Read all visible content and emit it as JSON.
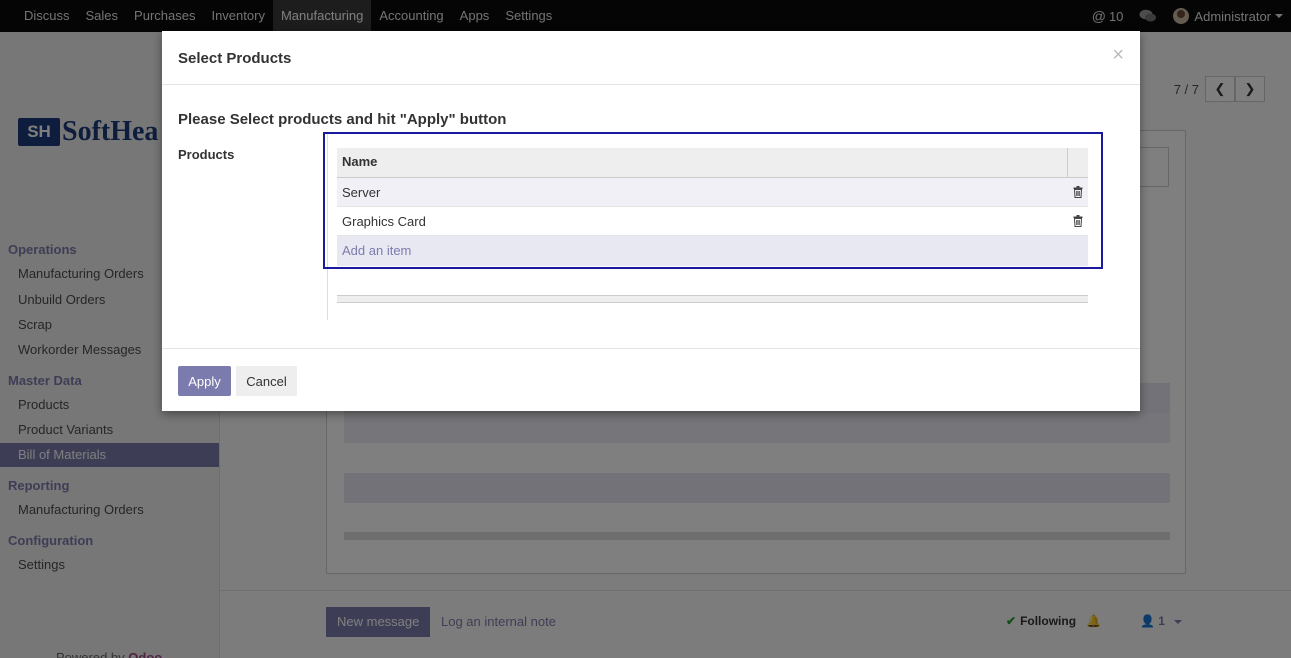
{
  "navbar": {
    "menu": [
      "Discuss",
      "Sales",
      "Purchases",
      "Inventory",
      "Manufacturing",
      "Accounting",
      "Apps",
      "Settings"
    ],
    "active": "Manufacturing",
    "mentions_count": "10",
    "user_name": "Administrator"
  },
  "sidebar": {
    "logo_mark": "SH",
    "logo_text": "SoftHea",
    "sections": [
      {
        "title": "Operations",
        "items": [
          "Manufacturing Orders",
          "Unbuild Orders",
          "Scrap",
          "Workorder Messages"
        ]
      },
      {
        "title": "Master Data",
        "items": [
          "Products",
          "Product Variants",
          "Bill of Materials"
        ]
      },
      {
        "title": "Reporting",
        "items": [
          "Manufacturing Orders"
        ]
      },
      {
        "title": "Configuration",
        "items": [
          "Settings"
        ]
      }
    ],
    "active_item": "Bill of Materials",
    "powered_by": "Powered by",
    "powered_brand": "Odoo"
  },
  "main": {
    "pager_value": "7 / 7"
  },
  "chatter": {
    "new_message": "New message",
    "log_note": "Log an internal note",
    "following": "Following",
    "followers_count": "1"
  },
  "modal": {
    "title": "Select Products",
    "close_symbol": "×",
    "instruction": "Please Select products and hit \"Apply\" button",
    "field_label": "Products",
    "table": {
      "column_name": "Name",
      "rows": [
        "Server",
        "Graphics Card"
      ],
      "add_item": "Add an item"
    },
    "apply_label": "Apply",
    "cancel_label": "Cancel"
  },
  "colors": {
    "accent": "#7c7bad",
    "highlight_border": "#1a1a9e",
    "navbar_bg": "#0b0b0b"
  }
}
